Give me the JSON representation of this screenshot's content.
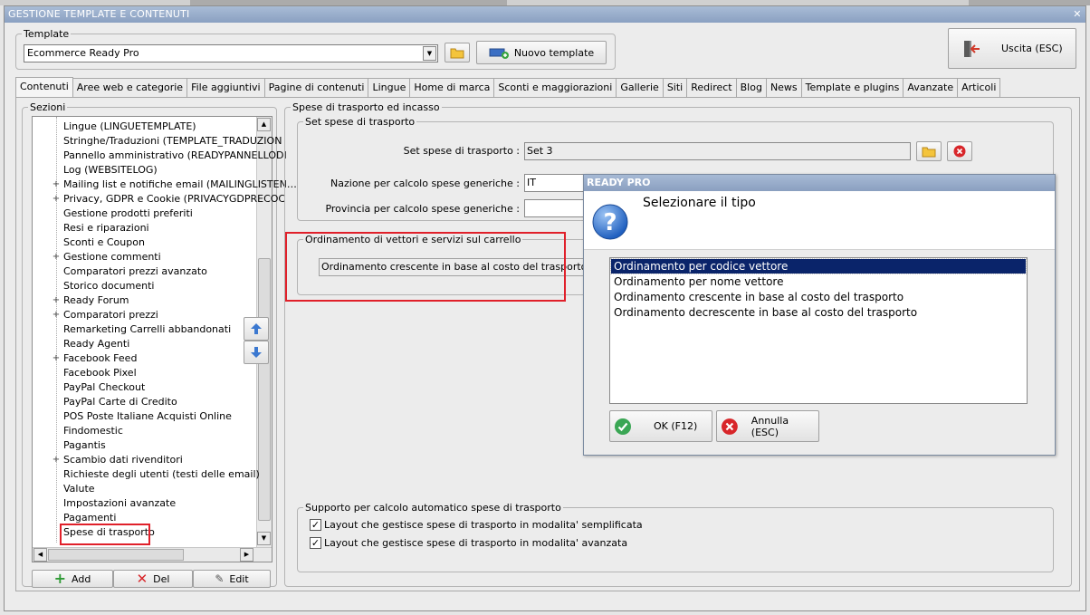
{
  "window": {
    "title": "GESTIONE TEMPLATE E CONTENUTI",
    "close_glyph": "✕"
  },
  "template": {
    "legend": "Template",
    "selected": "Ecommerce Ready Pro",
    "new_button": "Nuovo template",
    "exit_button": "Uscita (ESC)"
  },
  "tabs": [
    "Contenuti",
    "Aree web e categorie",
    "File aggiuntivi",
    "Pagine di contenuti",
    "Lingue",
    "Home di marca",
    "Sconti e maggiorazioni",
    "Gallerie",
    "Siti",
    "Redirect",
    "Blog",
    "News",
    "Template e plugins",
    "Avanzate",
    "Articoli"
  ],
  "sections": {
    "legend": "Sezioni",
    "items": [
      {
        "label": "Lingue (LINGUETEMPLATE)",
        "exp": ""
      },
      {
        "label": "Stringhe/Traduzioni (TEMPLATE_TRADUZION",
        "exp": ""
      },
      {
        "label": "Pannello amministrativo (READYPANNELLODI",
        "exp": ""
      },
      {
        "label": "Log (WEBSITELOG)",
        "exp": ""
      },
      {
        "label": "Mailing list e notifiche email (MAILINGLISTEN…",
        "exp": "+"
      },
      {
        "label": "Privacy, GDPR e Cookie (PRIVACYGDPRECOC",
        "exp": "+"
      },
      {
        "label": "Gestione prodotti preferiti",
        "exp": ""
      },
      {
        "label": "Resi e riparazioni",
        "exp": ""
      },
      {
        "label": "Sconti e Coupon",
        "exp": ""
      },
      {
        "label": "Gestione commenti",
        "exp": "+"
      },
      {
        "label": "Comparatori prezzi avanzato",
        "exp": ""
      },
      {
        "label": "Storico documenti",
        "exp": ""
      },
      {
        "label": "Ready Forum",
        "exp": "+"
      },
      {
        "label": "Comparatori prezzi",
        "exp": "+"
      },
      {
        "label": "Remarketing Carrelli abbandonati",
        "exp": ""
      },
      {
        "label": "Ready Agenti",
        "exp": ""
      },
      {
        "label": "Facebook Feed",
        "exp": "+"
      },
      {
        "label": "Facebook Pixel",
        "exp": ""
      },
      {
        "label": "PayPal Checkout",
        "exp": ""
      },
      {
        "label": "PayPal Carte di Credito",
        "exp": ""
      },
      {
        "label": "POS Poste Italiane Acquisti Online",
        "exp": ""
      },
      {
        "label": "Findomestic",
        "exp": ""
      },
      {
        "label": "Pagantis",
        "exp": ""
      },
      {
        "label": "Scambio dati rivenditori",
        "exp": "+"
      },
      {
        "label": "Richieste degli utenti (testi delle email)",
        "exp": ""
      },
      {
        "label": "Valute",
        "exp": ""
      },
      {
        "label": "Impostazioni avanzate",
        "exp": ""
      },
      {
        "label": "Pagamenti",
        "exp": ""
      },
      {
        "label": "Spese di trasporto",
        "exp": ""
      }
    ],
    "add_label": "Add",
    "del_label": "Del",
    "edit_label": "Edit"
  },
  "shipping": {
    "legend": "Spese di trasporto ed incasso",
    "set_legend": "Set spese di trasporto",
    "set_label": "Set spese di trasporto :",
    "set_value": "Set 3",
    "nation_label": "Nazione per calcolo spese generiche :",
    "nation_value": "IT",
    "province_label": "Provincia per calcolo spese generiche :",
    "province_value": "",
    "order_legend": "Ordinamento di vettori e servizi sul carrello",
    "order_value": "Ordinamento crescente in base al costo del trasporto",
    "support_legend": "Supporto per calcolo automatico spese di trasporto",
    "check1": "Layout che gestisce spese di trasporto in modalita' semplificata",
    "check2": "Layout che gestisce spese di trasporto in modalita' avanzata"
  },
  "dialog": {
    "title": "READY PRO",
    "heading": "Selezionare il tipo",
    "options": [
      "Ordinamento per codice vettore",
      "Ordinamento per nome vettore",
      "Ordinamento crescente in base al costo del trasporto",
      "Ordinamento decrescente in base al costo del trasporto"
    ],
    "ok_label": "OK (F12)",
    "cancel_label": "Annulla (ESC)"
  },
  "colors": {
    "accent": "#0a246a",
    "highlight": "#e0202a",
    "titlebar": "#8aa0c1"
  }
}
